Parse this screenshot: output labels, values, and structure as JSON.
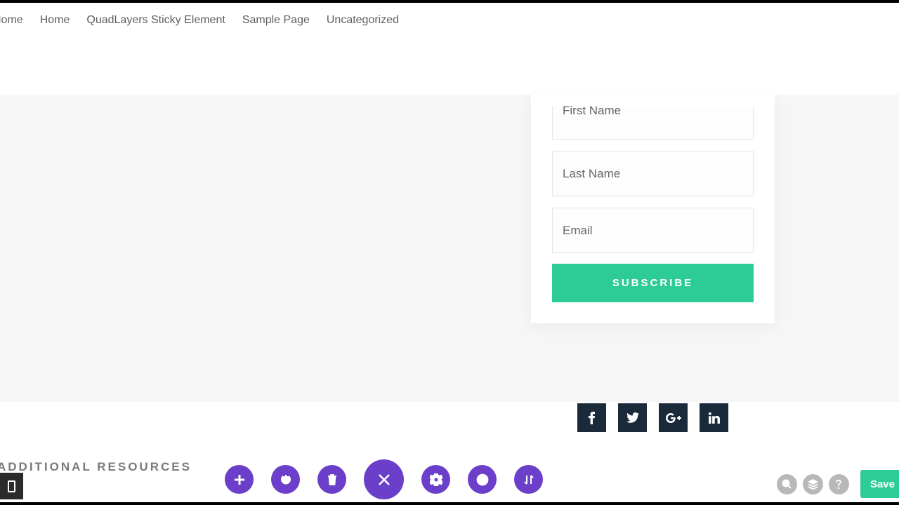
{
  "nav": {
    "items": [
      "Home",
      "Home",
      "QuadLayers Sticky Element",
      "Sample Page",
      "Uncategorized"
    ]
  },
  "form": {
    "first_name_placeholder": "First Name",
    "last_name_placeholder": "Last Name",
    "email_placeholder": "Email",
    "subscribe_label": "SUBSCRIBE"
  },
  "socials": {
    "facebook": "facebook-icon",
    "twitter": "twitter-icon",
    "googleplus": "google-plus-icon",
    "linkedin": "linkedin-icon"
  },
  "resources_heading": "ADDITIONAL RESOURCES",
  "builder_bar": {
    "mobile": "mobile-icon",
    "add": "plus-icon",
    "power": "power-icon",
    "trash": "trash-icon",
    "close": "close-icon",
    "settings": "gear-icon",
    "history": "clock-icon",
    "swap": "swap-icon",
    "search": "search-icon",
    "layers": "layers-icon",
    "help": "help-icon",
    "save_label": "Save"
  },
  "colors": {
    "accent_green": "#2dcc97",
    "purple": "#6b3fc9",
    "social_navy": "#1a2a3a"
  }
}
